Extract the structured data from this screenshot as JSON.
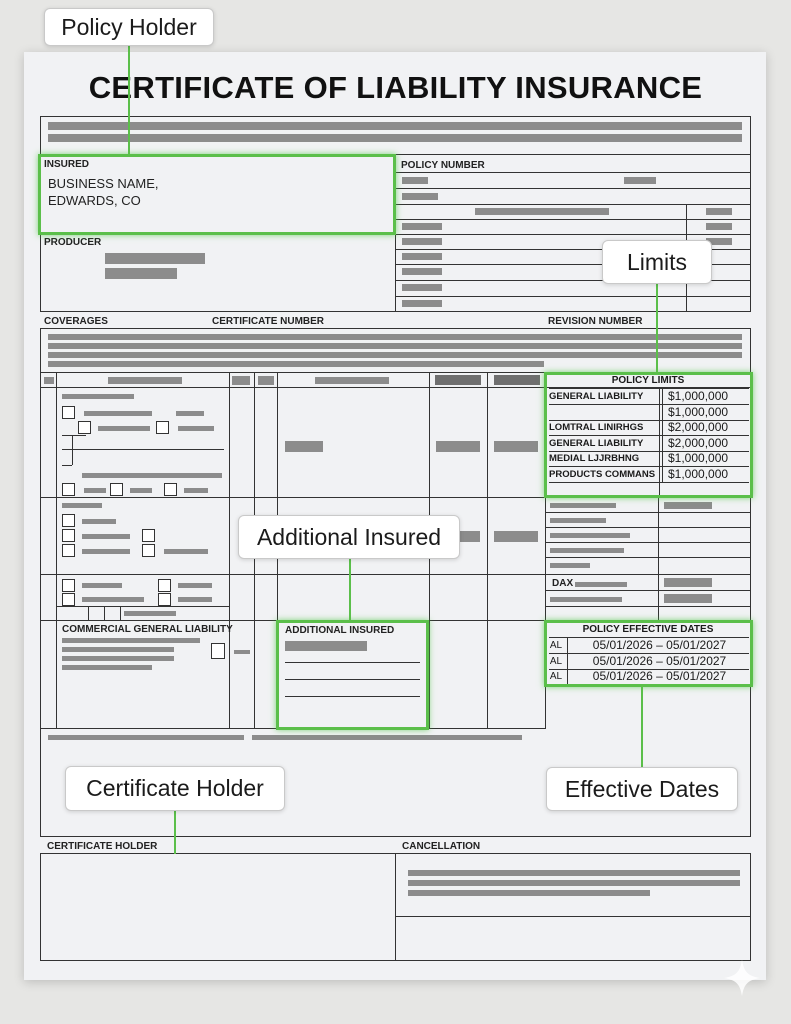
{
  "title": "CERTIFICATE OF LIABILITY INSURANCE",
  "sections": {
    "insured_label": "INSURED",
    "insured_line1": "BUSINESS NAME,",
    "insured_line2": "EDWARDS, CO",
    "policy_number_label": "POLICY NUMBER",
    "producer_label": "PRODUCER",
    "coverages_label": "COVERAGES",
    "certificate_number_label": "CERTIFICATE NUMBER",
    "revision_number_label": "REVISION NUMBER",
    "cgl_label": "COMMERCIAL GENERAL LIABILITY",
    "additional_insured_label": "ADDITIONAL INSURED",
    "dax_label": "DAX",
    "certificate_holder_label": "CERTIFICATE HOLDER",
    "cancellation_label": "CANCELLATION"
  },
  "policy_limits": {
    "header": "POLICY LIMITS",
    "rows": [
      {
        "name": "GENERAL LIABILITY",
        "amount": "$1,000,000"
      },
      {
        "name": "",
        "amount": "$1,000,000"
      },
      {
        "name": "LOMTRAL LINIRHGS",
        "amount": "$2,000,000"
      },
      {
        "name": "GENERAL LIABILITY",
        "amount": "$2,000,000"
      },
      {
        "name": "MEDIAL LJJRBHNG",
        "amount": "$1,000,000"
      },
      {
        "name": "PRODUCTS COMMANS",
        "amount": "$1,000,000"
      }
    ]
  },
  "effective_dates": {
    "header": "POLICY EFFECTIVE DATES",
    "rows": [
      {
        "code": "AL",
        "range": "05/01/2026 – 05/01/2027"
      },
      {
        "code": "AL",
        "range": "05/01/2026 – 05/01/2027"
      },
      {
        "code": "AL",
        "range": "05/01/2026 – 05/01/2027"
      }
    ]
  },
  "callouts": {
    "policy_holder": "Policy Holder",
    "limits": "Limits",
    "additional_insured": "Additional Insured",
    "certificate_holder": "Certificate Holder",
    "effective_dates": "Effective Dates"
  },
  "colors": {
    "highlight": "#5bbf4a",
    "redaction": "#8c8c8c"
  }
}
